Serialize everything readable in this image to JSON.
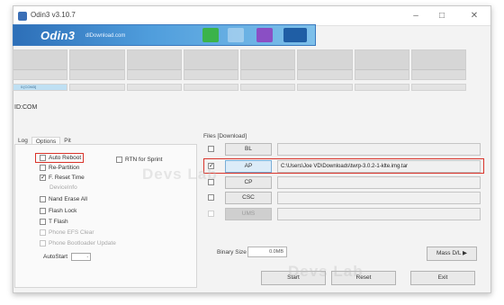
{
  "window": {
    "title": "Odin3 v3.10.7"
  },
  "banner": {
    "logo": "Odin3",
    "subtitle": "dlDownload.com"
  },
  "com_slot": {
    "label": "0:[COM3]"
  },
  "id_com": "ID:COM",
  "tabs": [
    "Log",
    "Options",
    "Pit"
  ],
  "options": {
    "auto_reboot": "Auto Reboot",
    "re_partition": "Re-Partition",
    "f_reset_time": "F. Reset Time",
    "device_info": "DeviceInfo",
    "nand_erase_all": "Nand Erase All",
    "flash_lock": "Flash Lock",
    "t_flash": "T Flash",
    "phone_efs_clear": "Phone EFS Clear",
    "phone_bootloader_update": "Phone Bootloader Update",
    "autostart": "AutoStart",
    "autostart_value": "-",
    "rtn_for_sprint": "RTN for Sprint"
  },
  "files": {
    "label": "Files [Download]",
    "rows": [
      {
        "button": "BL",
        "path": ""
      },
      {
        "button": "AP",
        "path": "C:\\Users\\Joe VD\\Downloads\\twrp-3.0.2-1-klte.img.tar"
      },
      {
        "button": "CP",
        "path": ""
      },
      {
        "button": "CSC",
        "path": ""
      },
      {
        "button": "UMS",
        "path": ""
      }
    ]
  },
  "binary": {
    "label": "Binary Size",
    "value": "0.0MB"
  },
  "buttons": {
    "mass_dl": "Mass D/L ▶",
    "start": "Start",
    "reset": "Reset",
    "exit": "Exit"
  },
  "watermark": "Devs Lab"
}
